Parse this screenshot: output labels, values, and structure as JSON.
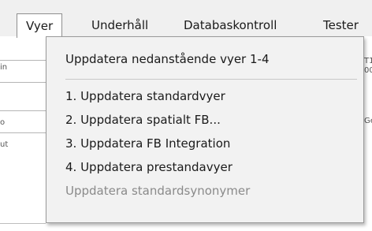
{
  "menubar": {
    "items": [
      {
        "label": "Vyer"
      },
      {
        "label": "Underhåll"
      },
      {
        "label": "Databaskontroll"
      },
      {
        "label": "Tester"
      }
    ]
  },
  "background": {
    "left_fragments": [
      "in",
      "o",
      "ut"
    ],
    "right_fragments": [
      "T1",
      "00",
      "Ge"
    ]
  },
  "dropdown": {
    "items": [
      {
        "label": "Uppdatera nedanstående vyer 1-4",
        "enabled": true
      },
      {
        "label": "1. Uppdatera standardvyer",
        "enabled": true
      },
      {
        "label": "2. Uppdatera spatialt FB...",
        "enabled": true
      },
      {
        "label": "3. Uppdatera FB Integration",
        "enabled": true
      },
      {
        "label": "4. Uppdatera prestandavyer",
        "enabled": true
      },
      {
        "label": "Uppdatera standardsynonymer",
        "enabled": false
      }
    ]
  }
}
